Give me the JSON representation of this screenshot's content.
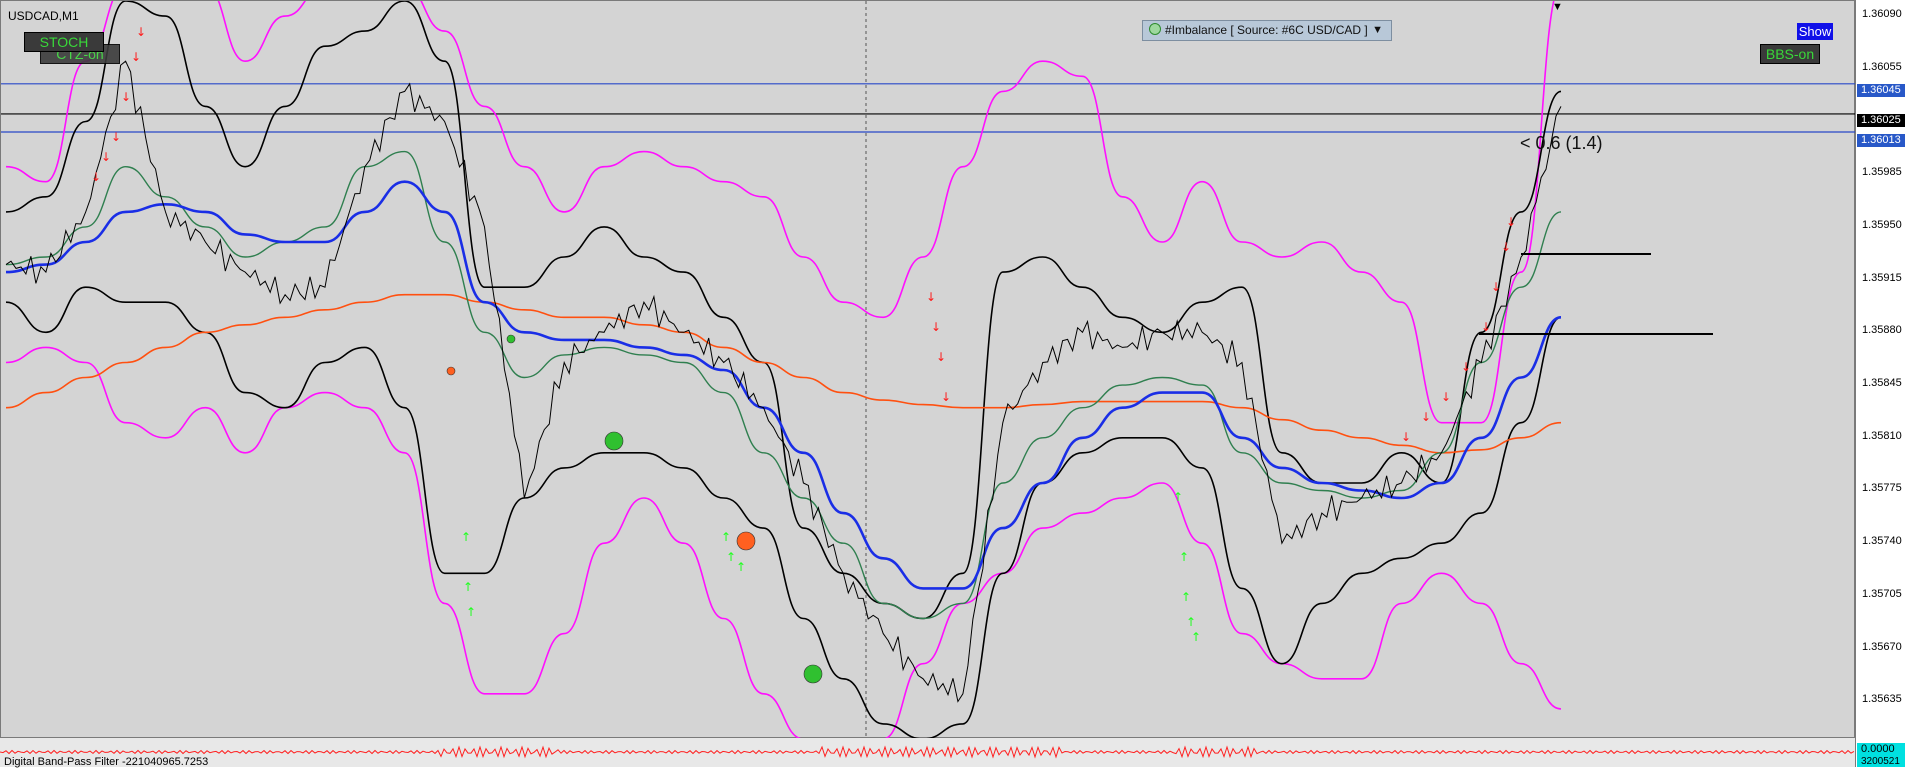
{
  "window": {
    "symbol_title": "USDCAD,M1"
  },
  "buttons": {
    "stoch": "STOCH",
    "ctz": "CTZ-on",
    "bbs": "BBS-on",
    "show": "Show"
  },
  "indicator_box": {
    "label": "#Imbalance [ Source: #6C USD/CAD ]"
  },
  "annotation": {
    "fib_text": "< 0.6 (1.4)"
  },
  "bottom_panel": {
    "label": "Digital Band-Pass Filter -221040965.7253"
  },
  "price_axis": {
    "ticks": [
      "1.36090",
      "1.36055",
      "1.35985",
      "1.35950",
      "1.35915",
      "1.35880",
      "1.35845",
      "1.35810",
      "1.35775",
      "1.35740",
      "1.35705",
      "1.35670",
      "1.35635"
    ],
    "tag_blue_upper": "1.36045",
    "tag_black": "1.36025",
    "tag_blue_lower": "1.36013",
    "tag_cyan": "0.0000",
    "tag_bottom": "3200521"
  },
  "colors": {
    "background": "#d4d4d4",
    "magenta_band": "#ff10ff",
    "black_band": "#000000",
    "blue_ma": "#1a2ee6",
    "green_ma": "#2f7f4f",
    "orange_ma": "#ff5010",
    "level_line": "#2848c8",
    "arrow_up": "#20ff20",
    "arrow_down": "#ff1a1a"
  },
  "chart_data": {
    "type": "line",
    "title": "USDCAD,M1",
    "ylim": [
      1.3561,
      1.361
    ],
    "x": [
      0,
      40,
      80,
      120,
      160,
      200,
      240,
      280,
      320,
      360,
      400,
      440,
      480,
      520,
      560,
      600,
      640,
      680,
      720,
      760,
      800,
      840,
      880,
      920,
      960,
      1000,
      1040,
      1080,
      1120,
      1160,
      1200,
      1240,
      1280,
      1320,
      1360,
      1400,
      1440,
      1480,
      1520,
      1560
    ],
    "series": [
      {
        "name": "",
        "role": "price",
        "color": "#000000",
        "values": [
          1.35925,
          1.3592,
          1.3596,
          1.3606,
          1.3596,
          1.3594,
          1.3592,
          1.35905,
          1.3591,
          1.3599,
          1.3604,
          1.3602,
          1.3595,
          1.3577,
          1.3586,
          1.3588,
          1.359,
          1.3588,
          1.3586,
          1.3583,
          1.3578,
          1.3572,
          1.3568,
          1.3565,
          1.3564,
          1.3582,
          1.3586,
          1.3588,
          1.3587,
          1.3588,
          1.3588,
          1.3586,
          1.3574,
          1.3576,
          1.3577,
          1.3578,
          1.358,
          1.3586,
          1.3593,
          1.3603
        ]
      },
      {
        "name": "",
        "role": "blue_ma",
        "color": "#1a2ee6",
        "values": [
          1.3592,
          1.35925,
          1.3594,
          1.3596,
          1.35965,
          1.3596,
          1.35945,
          1.3594,
          1.3594,
          1.3596,
          1.3598,
          1.3596,
          1.359,
          1.3588,
          1.35875,
          1.35875,
          1.3587,
          1.35865,
          1.35855,
          1.3583,
          1.358,
          1.3576,
          1.3573,
          1.3571,
          1.3571,
          1.3575,
          1.3578,
          1.3581,
          1.3583,
          1.3584,
          1.3584,
          1.3581,
          1.3579,
          1.3578,
          1.35775,
          1.3577,
          1.3578,
          1.3581,
          1.3585,
          1.3589
        ]
      },
      {
        "name": "",
        "role": "green_ma",
        "color": "#2f7f4f",
        "values": [
          1.35925,
          1.3593,
          1.3595,
          1.3599,
          1.3597,
          1.3595,
          1.3593,
          1.3594,
          1.3595,
          1.3599,
          1.36,
          1.3594,
          1.3588,
          1.3585,
          1.35865,
          1.3587,
          1.35865,
          1.3586,
          1.3584,
          1.358,
          1.3577,
          1.3574,
          1.357,
          1.3569,
          1.357,
          1.3578,
          1.3581,
          1.3583,
          1.35845,
          1.3585,
          1.35845,
          1.358,
          1.3578,
          1.35775,
          1.3577,
          1.35775,
          1.358,
          1.3586,
          1.3591,
          1.3596
        ]
      },
      {
        "name": "",
        "role": "orange_ma",
        "color": "#ff5010",
        "values": [
          1.3583,
          1.3584,
          1.3585,
          1.3586,
          1.3587,
          1.3588,
          1.35885,
          1.3589,
          1.35895,
          1.359,
          1.35905,
          1.35905,
          1.359,
          1.35895,
          1.3589,
          1.3589,
          1.35885,
          1.3588,
          1.3587,
          1.3586,
          1.3585,
          1.3584,
          1.35835,
          1.35832,
          1.3583,
          1.3583,
          1.35832,
          1.35834,
          1.35834,
          1.35834,
          1.35834,
          1.3583,
          1.35822,
          1.35815,
          1.3581,
          1.35805,
          1.358,
          1.35802,
          1.3581,
          1.3582
        ]
      },
      {
        "name": "",
        "role": "magenta_upper",
        "color": "#ff10ff",
        "values": [
          1.3599,
          1.3598,
          1.3606,
          1.3611,
          1.3611,
          1.3611,
          1.3606,
          1.3609,
          1.3611,
          1.3611,
          1.3611,
          1.3608,
          1.3603,
          1.3599,
          1.3596,
          1.3599,
          1.36,
          1.3599,
          1.3598,
          1.3597,
          1.3593,
          1.359,
          1.3589,
          1.3593,
          1.3599,
          1.3604,
          1.3606,
          1.3605,
          1.3597,
          1.3594,
          1.3598,
          1.3594,
          1.3593,
          1.3594,
          1.3592,
          1.359,
          1.3582,
          1.3582,
          1.3592,
          1.3611
        ]
      },
      {
        "name": "",
        "role": "magenta_lower",
        "color": "#ff10ff",
        "values": [
          1.3586,
          1.3587,
          1.3586,
          1.3582,
          1.3581,
          1.3583,
          1.358,
          1.3583,
          1.3584,
          1.3583,
          1.358,
          1.357,
          1.3564,
          1.3564,
          1.3568,
          1.3574,
          1.3577,
          1.3574,
          1.3569,
          1.3564,
          1.3561,
          1.3559,
          1.3561,
          1.3566,
          1.357,
          1.3572,
          1.3575,
          1.3576,
          1.3577,
          1.3578,
          1.3574,
          1.3568,
          1.3566,
          1.3565,
          1.3565,
          1.357,
          1.3572,
          1.357,
          1.3566,
          1.3563
        ]
      },
      {
        "name": "",
        "role": "black_upper",
        "color": "#000000",
        "values": [
          1.3596,
          1.3597,
          1.3602,
          1.361,
          1.3609,
          1.3603,
          1.3599,
          1.3603,
          1.3607,
          1.3608,
          1.361,
          1.3606,
          1.3591,
          1.3591,
          1.3593,
          1.3595,
          1.3593,
          1.3592,
          1.3589,
          1.3586,
          1.3575,
          1.3572,
          1.357,
          1.3569,
          1.3572,
          1.3592,
          1.3593,
          1.3591,
          1.3589,
          1.3588,
          1.359,
          1.3591,
          1.358,
          1.3578,
          1.3578,
          1.358,
          1.3578,
          1.3588,
          1.3596,
          1.3604
        ]
      },
      {
        "name": "",
        "role": "black_lower",
        "color": "#000000",
        "values": [
          1.359,
          1.3588,
          1.3591,
          1.359,
          1.359,
          1.3588,
          1.3584,
          1.3583,
          1.3586,
          1.3587,
          1.3583,
          1.3572,
          1.3572,
          1.3577,
          1.3579,
          1.358,
          1.358,
          1.3579,
          1.3577,
          1.3575,
          1.3569,
          1.3565,
          1.3562,
          1.3561,
          1.3562,
          1.3572,
          1.3578,
          1.358,
          1.3581,
          1.3581,
          1.3579,
          1.3571,
          1.3566,
          1.357,
          1.3572,
          1.3573,
          1.3574,
          1.3576,
          1.3582,
          1.3589
        ]
      }
    ],
    "levels": [
      {
        "price": 1.36045,
        "color": "#2848c8"
      },
      {
        "price": 1.36025,
        "color": "#000000"
      },
      {
        "price": 1.36013,
        "color": "#2848c8"
      }
    ],
    "grid": false
  }
}
